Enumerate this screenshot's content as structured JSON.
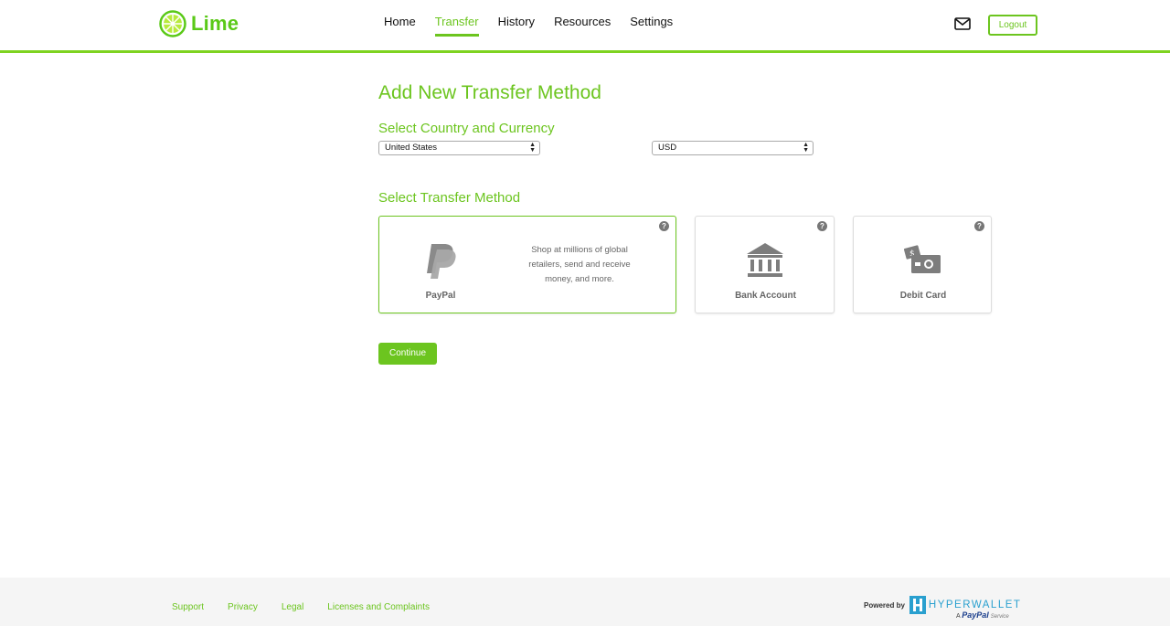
{
  "header": {
    "brand": "Lime",
    "nav": [
      {
        "label": "Home",
        "active": false
      },
      {
        "label": "Transfer",
        "active": true
      },
      {
        "label": "History",
        "active": false
      },
      {
        "label": "Resources",
        "active": false
      },
      {
        "label": "Settings",
        "active": false
      }
    ],
    "mail_icon": "envelope-icon",
    "logout_label": "Logout"
  },
  "main": {
    "title": "Add New Transfer Method",
    "country_section_title": "Select Country and Currency",
    "country_value": "United States",
    "currency_value": "USD",
    "method_section_title": "Select Transfer Method",
    "methods": [
      {
        "label": "PayPal",
        "icon": "paypal-icon",
        "selected": true,
        "description": "Shop at millions of global retailers, send and receive money, and more."
      },
      {
        "label": "Bank Account",
        "icon": "bank-icon",
        "selected": false
      },
      {
        "label": "Debit Card",
        "icon": "debit-card-icon",
        "selected": false
      }
    ],
    "help_glyph": "?",
    "continue_label": "Continue"
  },
  "footer": {
    "links": [
      "Support",
      "Privacy",
      "Legal",
      "Licenses and Complaints"
    ],
    "powered_by": "Powered by",
    "hyperwallet": "HYPERWALLET",
    "paypal_service_prefix": "A",
    "paypal_service_brand": "PayPal",
    "paypal_service_suffix": "Service"
  },
  "colors": {
    "accent": "#6cc51f",
    "header_border": "#7ed321",
    "icon_gray": "#7d7d7d",
    "hyperwallet_blue": "#2aa0cf"
  }
}
